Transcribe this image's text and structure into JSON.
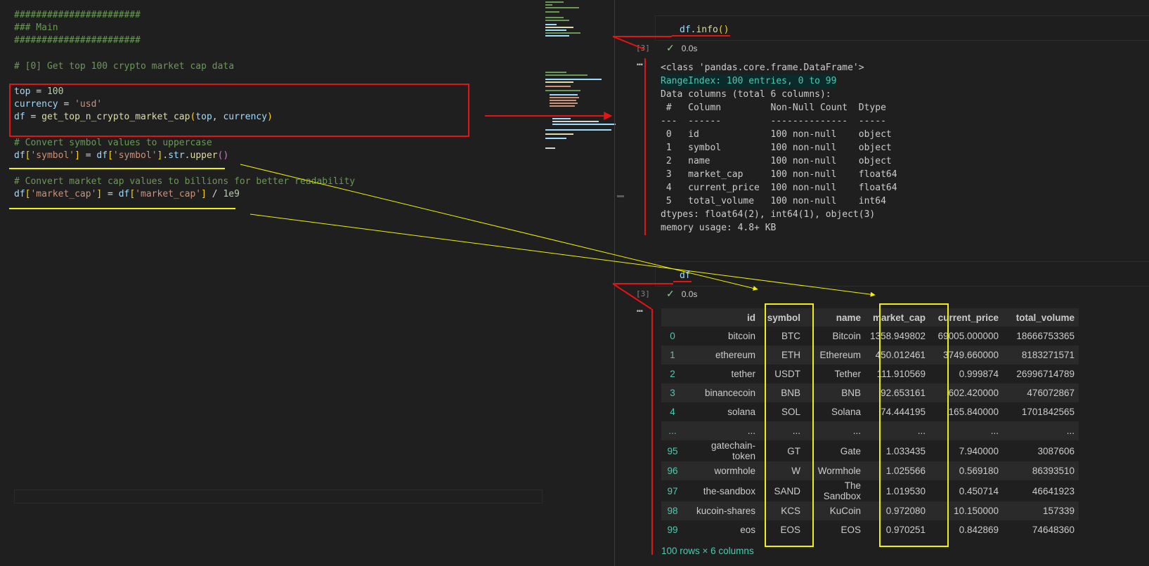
{
  "editor": {
    "lines": {
      "l1": "#######################",
      "l2": "### Main",
      "l3": "#######################",
      "l4": "# [0] Get top 100 crypto market cap data",
      "top_var": "top",
      "top_val": "100",
      "cur_var": "currency",
      "cur_val": "'usd'",
      "df_var": "df",
      "df_fn": "get_top_n_crypto_market_cap",
      "df_arg1": "top",
      "df_arg2": "currency",
      "c1": "# Convert symbol values to uppercase",
      "sym_a": "df",
      "sym_key": "'symbol'",
      "sym_b": "df",
      "sym_key2": "'symbol'",
      "sym_str": "str",
      "sym_fn": "upper",
      "c2": "# Convert market cap values to billions for better readability",
      "mc_a": "df",
      "mc_key": "'market_cap'",
      "mc_b": "df",
      "mc_key2": "'market_cap'",
      "mc_div": "1e9"
    }
  },
  "cell1": {
    "code_obj": "df",
    "code_fn": "info",
    "exec_count": "[3]",
    "time": "0.0s",
    "output": [
      "<class 'pandas.core.frame.DataFrame'>",
      "RangeIndex: 100 entries, 0 to 99",
      "Data columns (total 6 columns):",
      " #   Column         Non-Null Count  Dtype  ",
      "---  ------         --------------  -----  ",
      " 0   id             100 non-null    object ",
      " 1   symbol         100 non-null    object ",
      " 2   name           100 non-null    object ",
      " 3   market_cap     100 non-null    float64",
      " 4   current_price  100 non-null    float64",
      " 5   total_volume   100 non-null    int64  ",
      "dtypes: float64(2), int64(1), object(3)",
      "memory usage: 4.8+ KB"
    ]
  },
  "cell2": {
    "code": "df",
    "exec_count": "[3]",
    "time": "0.0s",
    "columns": [
      "id",
      "symbol",
      "name",
      "market_cap",
      "current_price",
      "total_volume"
    ],
    "rows": [
      [
        "0",
        "bitcoin",
        "BTC",
        "Bitcoin",
        "1358.949802",
        "69005.000000",
        "18666753365"
      ],
      [
        "1",
        "ethereum",
        "ETH",
        "Ethereum",
        "450.012461",
        "3749.660000",
        "8183271571"
      ],
      [
        "2",
        "tether",
        "USDT",
        "Tether",
        "111.910569",
        "0.999874",
        "26996714789"
      ],
      [
        "3",
        "binancecoin",
        "BNB",
        "BNB",
        "92.653161",
        "602.420000",
        "476072867"
      ],
      [
        "4",
        "solana",
        "SOL",
        "Solana",
        "74.444195",
        "165.840000",
        "1701842565"
      ],
      [
        "...",
        "...",
        "...",
        "...",
        "...",
        "...",
        "..."
      ],
      [
        "95",
        "gatechain-token",
        "GT",
        "Gate",
        "1.033435",
        "7.940000",
        "3087606"
      ],
      [
        "96",
        "wormhole",
        "W",
        "Wormhole",
        "1.025566",
        "0.569180",
        "86393510"
      ],
      [
        "97",
        "the-sandbox",
        "SAND",
        "The Sandbox",
        "1.019530",
        "0.450714",
        "46641923"
      ],
      [
        "98",
        "kucoin-shares",
        "KCS",
        "KuCoin",
        "0.972080",
        "10.150000",
        "157339"
      ],
      [
        "99",
        "eos",
        "EOS",
        "EOS",
        "0.970251",
        "0.842869",
        "74648360"
      ]
    ],
    "footer": "100 rows × 6 columns"
  },
  "icons": {
    "check": "check-icon",
    "more": "more-icon"
  },
  "colors": {
    "annotation_red": "#e31414",
    "annotation_yellow": "#f2f200",
    "teal": "#4ec9b0"
  }
}
